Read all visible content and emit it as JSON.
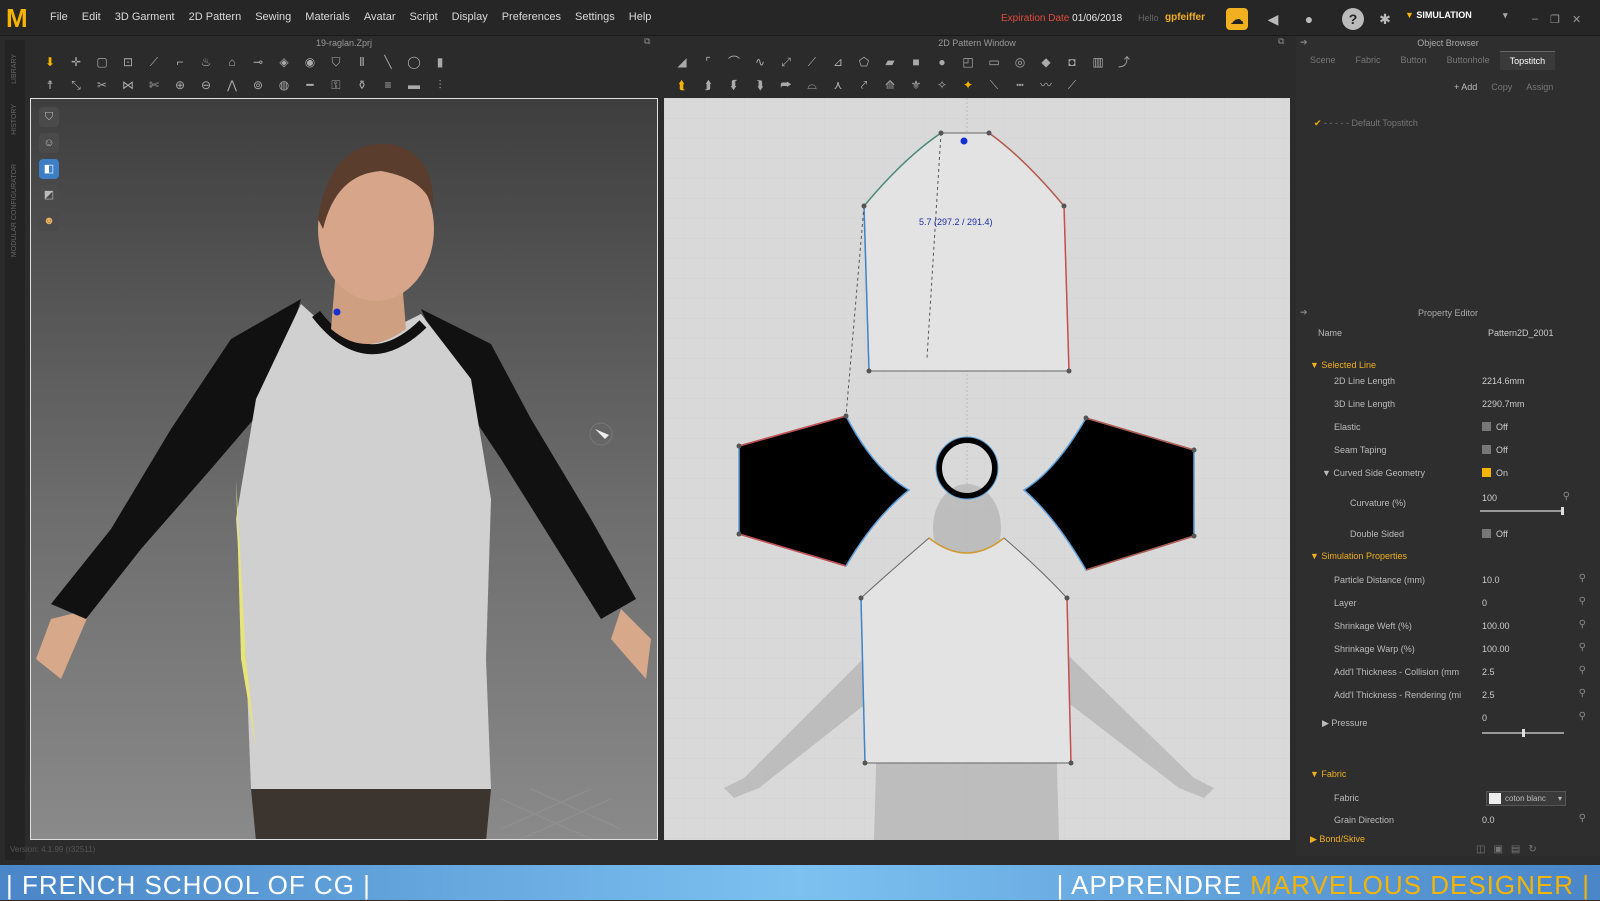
{
  "menubar": {
    "logo": "M",
    "items": [
      "File",
      "Edit",
      "3D Garment",
      "2D Pattern",
      "Sewing",
      "Materials",
      "Avatar",
      "Script",
      "Display",
      "Preferences",
      "Settings",
      "Help"
    ],
    "expiration_label": "Expiration Date",
    "expiration_date": "01/06/2018",
    "hello": "Hello",
    "username": "gpfeiffer",
    "simulation_label": "SIMULATION"
  },
  "sidebar": {
    "library": "LIBRARY",
    "history": "HISTORY",
    "modular": "MODULAR CONFIGURATOR"
  },
  "view3d": {
    "file_title": "19-raglan.Zprj"
  },
  "view2d": {
    "title": "2D Pattern Window",
    "measure": "5.7 (297.2 / 291.4)"
  },
  "object_browser": {
    "title": "Object Browser",
    "tabs": [
      "Scene",
      "Fabric",
      "Button",
      "Buttonhole",
      "Topstitch"
    ],
    "active_tab": "Topstitch",
    "actions": [
      "+ Add",
      "Copy",
      "Assign"
    ],
    "item": "- - - - -   Default Topstitch"
  },
  "property_editor": {
    "title": "Property Editor",
    "name_label": "Name",
    "name_value": "Pattern2D_2001",
    "selected_line": "Selected Line",
    "line2d_label": "2D Line Length",
    "line2d_value": "2214.6mm",
    "line3d_label": "3D Line Length",
    "line3d_value": "2290.7mm",
    "elastic_label": "Elastic",
    "elastic_value": "Off",
    "seam_label": "Seam Taping",
    "seam_value": "Off",
    "curved_label": "Curved Side Geometry",
    "curved_value": "On",
    "curvature_label": "Curvature (%)",
    "curvature_value": "100",
    "double_label": "Double Sided",
    "double_value": "Off",
    "sim_props": "Simulation Properties",
    "particle_label": "Particle Distance (mm)",
    "particle_value": "10.0",
    "layer_label": "Layer",
    "layer_value": "0",
    "weft_label": "Shrinkage Weft (%)",
    "weft_value": "100.00",
    "warp_label": "Shrinkage Warp (%)",
    "warp_value": "100.00",
    "collision_label": "Add'l Thickness - Collision (mm",
    "collision_value": "2.5",
    "rendering_label": "Add'l Thickness - Rendering (mi",
    "rendering_value": "2.5",
    "pressure_label": "Pressure",
    "pressure_value": "0",
    "fabric_section": "Fabric",
    "fabric_label": "Fabric",
    "fabric_value": "coton blanc",
    "grain_label": "Grain Direction",
    "grain_value": "0.0",
    "bond_label": "Bond/Skive"
  },
  "footer": {
    "version": "Version: 4.1.99 (r32511)"
  },
  "banner": {
    "left": "| FRENCH SCHOOL OF CG |",
    "right_a": "| APPRENDRE ",
    "right_b": "MARVELOUS DESIGNER |"
  },
  "colors": {
    "accent": "#f5b400",
    "expiry": "#e04a3a",
    "banner": "#6fb5ea"
  }
}
